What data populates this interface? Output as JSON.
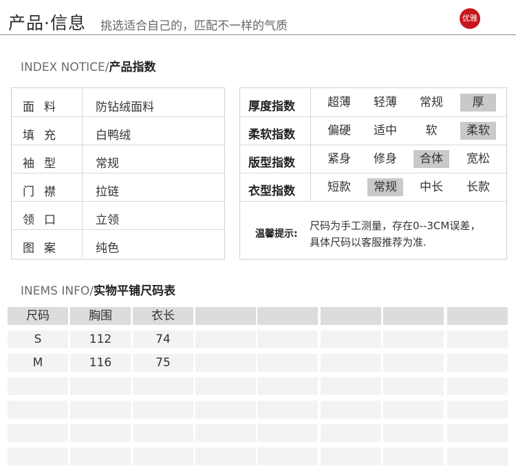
{
  "header": {
    "title": "产品·信息",
    "subtitle": "挑选适合自己的，匹配不一样的气质",
    "badge": "优雅"
  },
  "index_section": {
    "prefix": "INDEX NOTICE/",
    "title": "产品指数"
  },
  "specs": [
    {
      "key": "面料",
      "value": "防钻绒面料"
    },
    {
      "key": "填充",
      "value": "白鸭绒"
    },
    {
      "key": "袖型",
      "value": "常规"
    },
    {
      "key": "门襟",
      "value": "拉链"
    },
    {
      "key": "领口",
      "value": "立领"
    },
    {
      "key": "图案",
      "value": "纯色"
    }
  ],
  "indices": [
    {
      "label": "厚度指数",
      "options": [
        "超薄",
        "轻薄",
        "常规",
        "厚"
      ],
      "selected": "厚"
    },
    {
      "label": "柔软指数",
      "options": [
        "偏硬",
        "适中",
        "软",
        "柔软"
      ],
      "selected": "柔软"
    },
    {
      "label": "版型指数",
      "options": [
        "紧身",
        "修身",
        "合体",
        "宽松"
      ],
      "selected": "合体"
    },
    {
      "label": "衣型指数",
      "options": [
        "短款",
        "常规",
        "中长",
        "长款"
      ],
      "selected": "常规"
    }
  ],
  "notice": {
    "label": "温馨提示:",
    "lines": [
      "尺码为手工测量，存在0--3CM误差，",
      "具体尺码以客服推荐为准."
    ]
  },
  "size_section": {
    "prefix": "INEMS INFO/",
    "title": "实物平铺尺码表"
  },
  "size_table": {
    "headers": [
      "尺码",
      "胸围",
      "衣长",
      "",
      "",
      "",
      "",
      ""
    ],
    "rows": [
      [
        "S",
        "112",
        "74",
        "",
        "",
        "",
        "",
        ""
      ],
      [
        "M",
        "116",
        "75",
        "",
        "",
        "",
        "",
        ""
      ],
      [
        "",
        "",
        "",
        "",
        "",
        "",
        "",
        ""
      ],
      [
        "",
        "",
        "",
        "",
        "",
        "",
        "",
        ""
      ],
      [
        "",
        "",
        "",
        "",
        "",
        "",
        "",
        ""
      ],
      [
        "",
        "",
        "",
        "",
        "",
        "",
        "",
        ""
      ]
    ]
  }
}
